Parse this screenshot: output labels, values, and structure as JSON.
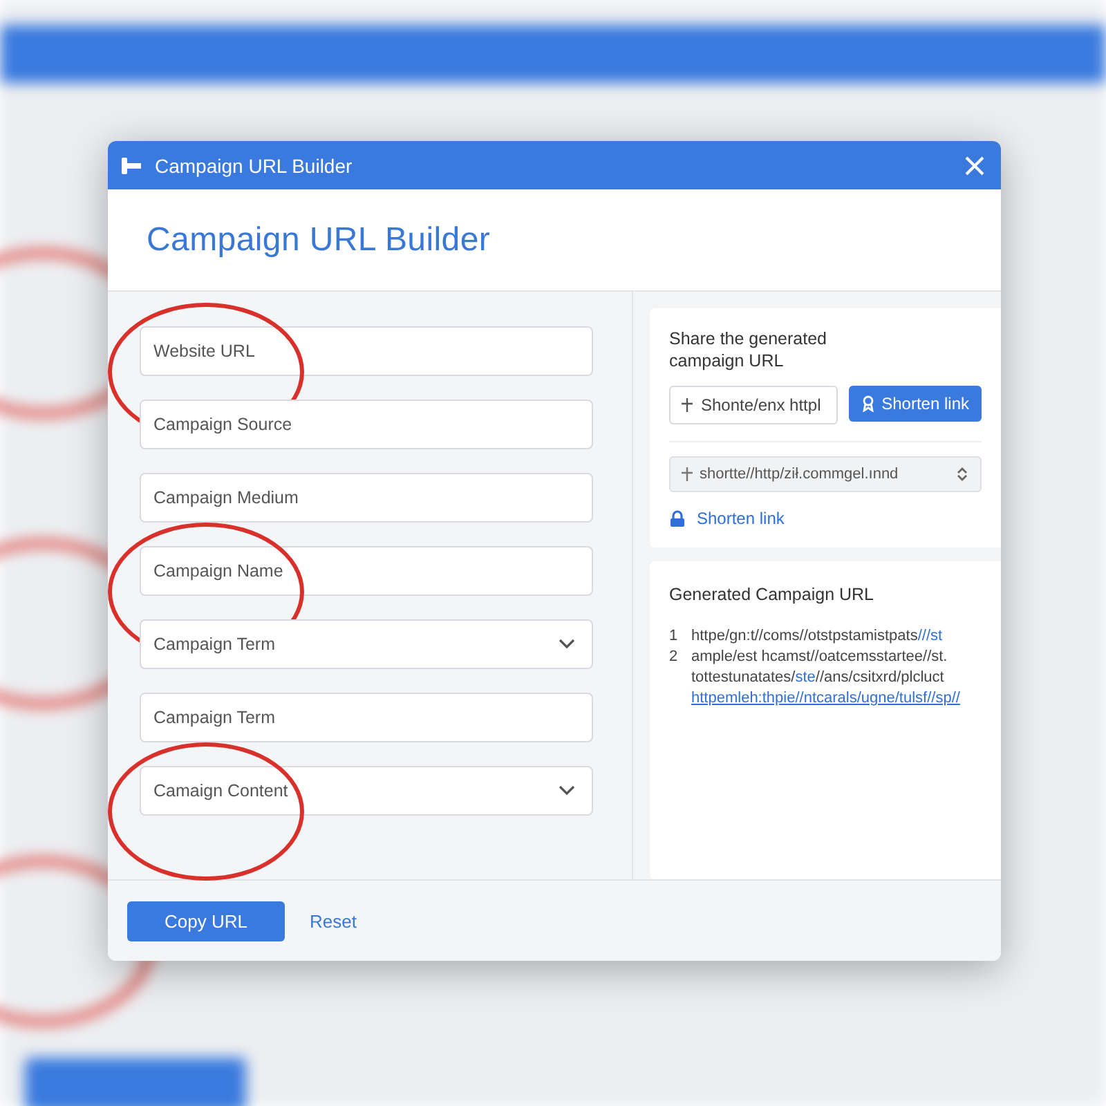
{
  "window": {
    "title": "Campaign URL Builder",
    "heading": "Campaign URL Builder"
  },
  "fields": [
    {
      "placeholder": "Website URL",
      "kind": "text",
      "highlighted": true
    },
    {
      "placeholder": "Campaign Source",
      "kind": "text",
      "highlighted": false
    },
    {
      "placeholder": "Campaign Medium",
      "kind": "text",
      "highlighted": false
    },
    {
      "placeholder": "Campaign Name",
      "kind": "text",
      "highlighted": true
    },
    {
      "placeholder": "Campaign Term",
      "kind": "dropdown",
      "highlighted": false
    },
    {
      "placeholder": "Campaign Term",
      "kind": "text",
      "highlighted": false
    },
    {
      "placeholder": "Camaign Content",
      "kind": "dropdown",
      "highlighted": true
    }
  ],
  "share": {
    "title": "Share the generated campaign URL",
    "input_value": "Shonte/enx httpl",
    "button": "Shorten link",
    "short_url": "shortte//http/ził.commgel.ınnd",
    "link": "Shorten link"
  },
  "generated": {
    "title": "Generated Campaign URL",
    "lines": [
      {
        "number": "1",
        "parts": [
          {
            "text": "httpe/gn:t//coms//otstpstamistpats",
            "kind": "plain"
          },
          {
            "text": "///st",
            "kind": "link"
          }
        ]
      },
      {
        "number": "2",
        "parts": [
          {
            "text": "ample/est hcamst//oatcemsstartee//st.",
            "kind": "plain"
          }
        ]
      },
      {
        "parts": [
          {
            "text": "tottestunatates/",
            "kind": "plain"
          },
          {
            "text": "ste",
            "kind": "link"
          },
          {
            "text": "//ans/csitxrd/plcluct",
            "kind": "plain"
          }
        ]
      },
      {
        "parts": [
          {
            "text": "httpemleh:thpie//ntcarals/ugne/tulsf//sp//",
            "kind": "underlined"
          }
        ]
      }
    ]
  },
  "buttons": [
    {
      "label": "Copy URL",
      "kind": "primary"
    },
    {
      "label": "Reset",
      "kind": "link"
    }
  ]
}
